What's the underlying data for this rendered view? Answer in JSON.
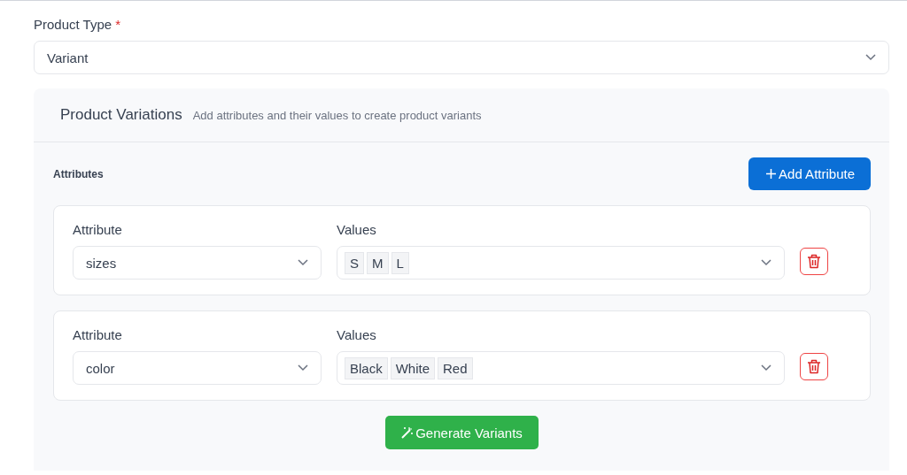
{
  "product_type": {
    "label": "Product Type",
    "required_mark": "*",
    "value": "Variant"
  },
  "variations": {
    "title": "Product Variations",
    "subtitle": "Add attributes and their values to create product variants",
    "attributes_label": "Attributes",
    "add_button": "Add Attribute",
    "rows": [
      {
        "attribute_label": "Attribute",
        "attribute": "sizes",
        "values_label": "Values",
        "values": [
          "S",
          "M",
          "L"
        ]
      },
      {
        "attribute_label": "Attribute",
        "attribute": "color",
        "values_label": "Values",
        "values": [
          "Black",
          "White",
          "Red"
        ]
      }
    ],
    "generate_button": "Generate Variants"
  }
}
